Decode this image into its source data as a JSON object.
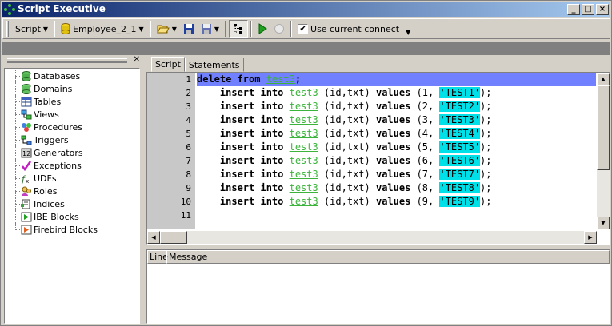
{
  "window": {
    "title": "Script Executive",
    "min_label": "_",
    "max_label": "□",
    "close_label": "×"
  },
  "toolbar": {
    "script_label": "Script",
    "connection_label": "Employee_2_1",
    "use_current_label": "Use current connect",
    "checkbox_value": "✔"
  },
  "tree": {
    "items": [
      {
        "label": "Databases"
      },
      {
        "label": "Domains"
      },
      {
        "label": "Tables"
      },
      {
        "label": "Views"
      },
      {
        "label": "Procedures"
      },
      {
        "label": "Triggers"
      },
      {
        "label": "Generators"
      },
      {
        "label": "Exceptions"
      },
      {
        "label": "UDFs"
      },
      {
        "label": "Roles"
      },
      {
        "label": "Indices"
      },
      {
        "label": "IBE Blocks"
      },
      {
        "label": "Firebird Blocks"
      }
    ]
  },
  "tabs": [
    {
      "label": "Script"
    },
    {
      "label": "Statements"
    }
  ],
  "editor": {
    "line_numbers": [
      "1",
      "2",
      "3",
      "4",
      "5",
      "6",
      "7",
      "8",
      "9",
      "10",
      "11"
    ],
    "line1": {
      "kw": "delete from ",
      "table": "test3",
      "end": ";"
    },
    "insert_kw": "insert into ",
    "table": "test3",
    "cols": " (id,txt) ",
    "values_kw": "values ",
    "rows": [
      {
        "num": "(1, ",
        "str": "'TEST1'"
      },
      {
        "num": "(2, ",
        "str": "'TEST2'"
      },
      {
        "num": "(3, ",
        "str": "'TEST3'"
      },
      {
        "num": "(4, ",
        "str": "'TEST4'"
      },
      {
        "num": "(5, ",
        "str": "'TEST5'"
      },
      {
        "num": "(6, ",
        "str": "'TEST6'"
      },
      {
        "num": "(7, ",
        "str": "'TEST7'"
      },
      {
        "num": "(8, ",
        "str": "'TEST8'"
      },
      {
        "num": "(9, ",
        "str": "'TEST9'"
      }
    ],
    "row_end": ");"
  },
  "messages": {
    "col_line": "Line",
    "col_message": "Message"
  }
}
